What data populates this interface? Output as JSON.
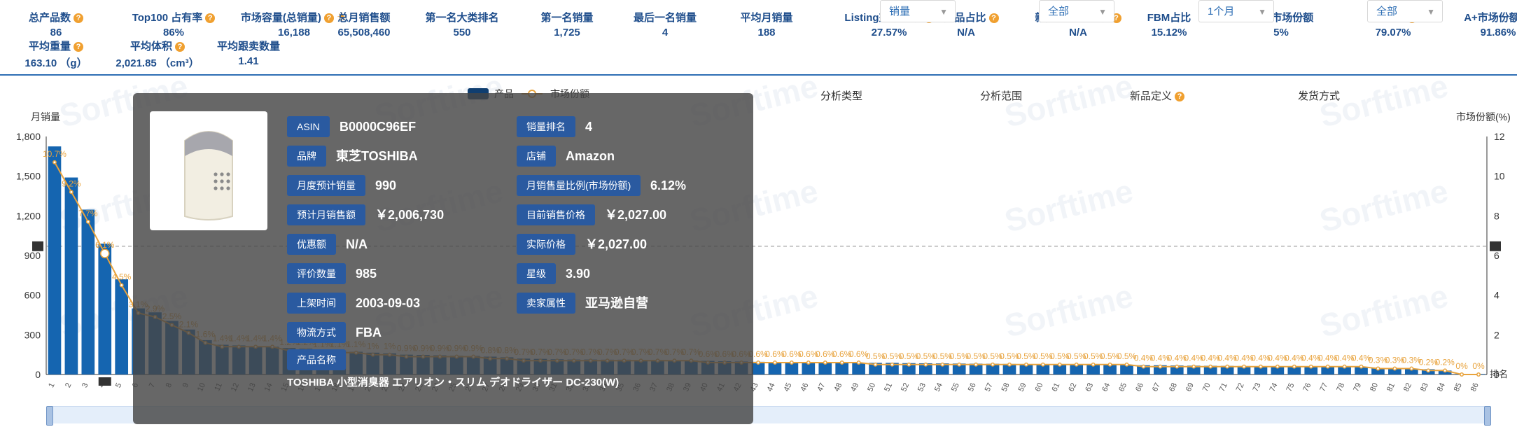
{
  "stats": [
    {
      "label": "总产品数",
      "value": "86",
      "help": true
    },
    {
      "label": "Top100 占有率",
      "value": "86%",
      "help": true
    },
    {
      "label": "市场容量(总销量)",
      "value": "16,188",
      "help": true,
      "sun": true
    },
    {
      "label": "总月销售额",
      "value": "65,508,460"
    },
    {
      "label": "第一名大类排名",
      "value": "550"
    },
    {
      "label": "第一名销量",
      "value": "1,725"
    },
    {
      "label": "最后一名销量",
      "value": "4"
    },
    {
      "label": "平均月销量",
      "value": "188"
    },
    {
      "label": "Listing垄断系数",
      "value": "27.57%",
      "help": true
    },
    {
      "label": "新产品占比",
      "value": "N/A",
      "help": true
    },
    {
      "label": "新产品市场份额",
      "value": "N/A",
      "help": true
    },
    {
      "label": "FBM占比",
      "value": "15.12%"
    },
    {
      "label": "FBM市场份额",
      "value": "5%"
    },
    {
      "label": "A+占比",
      "value": "79.07%",
      "help": true
    },
    {
      "label": "A+市场份额",
      "value": "91.86%",
      "help": true
    },
    {
      "label": "平均重量",
      "value": "163.10 （g）",
      "help": true
    },
    {
      "label": "平均体积",
      "value": "2,021.85 （cm³）",
      "help": true
    },
    {
      "label": "平均跟卖数量",
      "value": "1.41"
    }
  ],
  "controls": [
    {
      "label": "分析类型",
      "value": "销量"
    },
    {
      "label": "分析范围",
      "value": "全部"
    },
    {
      "label": "新品定义",
      "value": "1个月",
      "help": true
    },
    {
      "label": "发货方式",
      "value": "全部"
    }
  ],
  "watermark": "Sorftime",
  "tooltip": {
    "fields": [
      {
        "label": "ASIN",
        "value": "B0000C96EF"
      },
      {
        "label": "销量排名",
        "value": "4"
      },
      {
        "label": "品牌",
        "value": "東芝TOSHIBA"
      },
      {
        "label": "店铺",
        "value": "Amazon"
      },
      {
        "label": "月度预计销量",
        "value": "990"
      },
      {
        "label": "月销售量比例(市场份额)",
        "value": "6.12%"
      },
      {
        "label": "预计月销售额",
        "value": "￥2,006,730"
      },
      {
        "label": "目前销售价格",
        "value": "￥2,027.00"
      },
      {
        "label": "优惠额",
        "value": "N/A"
      },
      {
        "label": "实际价格",
        "value": "￥2,027.00"
      },
      {
        "label": "评价数量",
        "value": "985"
      },
      {
        "label": "星级",
        "value": "3.90"
      },
      {
        "label": "上架时间",
        "value": "2003-09-03"
      },
      {
        "label": "卖家属性",
        "value": "亚马逊自营"
      },
      {
        "label": "物流方式",
        "value": "FBA"
      }
    ],
    "name_label": "产品名称",
    "name": "TOSHIBA 小型消臭器 エアリオン・スリム デオドライザー DC-230(W)"
  },
  "colors": {
    "bar": "#1565b0",
    "line": "#e8a33d",
    "label": "#e8a33d",
    "axis": "#666666",
    "header": "#1f4e8c"
  },
  "chart_data": {
    "type": "bar",
    "title": "",
    "legend": [
      "产品",
      "市场份额"
    ],
    "legend_position": "top-center",
    "ylabel_left": "月销量",
    "ylabel_right": "市场份额(%)",
    "xlabel": "排名",
    "ylim_left": [
      0,
      1800
    ],
    "yticks_left": [
      "0",
      "300",
      "600",
      "900",
      "1,200",
      "1,500",
      "1,800"
    ],
    "ylim_right": [
      0,
      12
    ],
    "yticks_right": [
      "0",
      "2",
      "4",
      "6",
      "8",
      "10",
      "12"
    ],
    "mean_line": 970,
    "highlight_index": 4,
    "categories": [
      "1",
      "2",
      "3",
      "4",
      "5",
      "6",
      "7",
      "8",
      "9",
      "10",
      "11",
      "12",
      "13",
      "14",
      "15",
      "16",
      "17",
      "18",
      "19",
      "20",
      "21",
      "22",
      "23",
      "24",
      "25",
      "26",
      "27",
      "28",
      "29",
      "30",
      "31",
      "32",
      "33",
      "34",
      "35",
      "36",
      "37",
      "38",
      "39",
      "40",
      "41",
      "42",
      "43",
      "44",
      "45",
      "46",
      "47",
      "48",
      "49",
      "50",
      "51",
      "52",
      "53",
      "54",
      "55",
      "56",
      "57",
      "58",
      "59",
      "60",
      "61",
      "62",
      "63",
      "64",
      "65",
      "66",
      "67",
      "68",
      "69",
      "70",
      "71",
      "72",
      "73",
      "74",
      "75",
      "76",
      "77",
      "78",
      "79",
      "80",
      "81",
      "82",
      "83",
      "84",
      "85",
      "86"
    ],
    "series": [
      {
        "name": "产品",
        "axis": "left",
        "values": [
          1725,
          1490,
          1247,
          990,
          720,
          500,
          470,
          405,
          340,
          260,
          225,
          220,
          210,
          210,
          200,
          195,
          185,
          180,
          172,
          165,
          160,
          150,
          148,
          145,
          142,
          140,
          135,
          130,
          120,
          118,
          115,
          113,
          113,
          112,
          112,
          110,
          110,
          108,
          106,
          103,
          100,
          98,
          96,
          95,
          95,
          93,
          92,
          92,
          90,
          88,
          88,
          86,
          85,
          84,
          83,
          82,
          81,
          80,
          79,
          78,
          78,
          76,
          75,
          75,
          74,
          70,
          70,
          68,
          67,
          66,
          65,
          64,
          63,
          62,
          61,
          60,
          60,
          58,
          57,
          50,
          48,
          45,
          40,
          30,
          4,
          4
        ]
      },
      {
        "name": "市场份额",
        "axis": "right",
        "values": [
          10.7,
          9.2,
          7.7,
          6.1,
          4.5,
          3.1,
          2.9,
          2.5,
          2.1,
          1.6,
          1.4,
          1.4,
          1.4,
          1.4,
          1.2,
          1.2,
          1.1,
          1.1,
          1.1,
          1.0,
          1.0,
          0.9,
          0.9,
          0.9,
          0.9,
          0.9,
          0.8,
          0.8,
          0.7,
          0.7,
          0.7,
          0.7,
          0.7,
          0.7,
          0.7,
          0.7,
          0.7,
          0.7,
          0.7,
          0.6,
          0.6,
          0.6,
          0.6,
          0.6,
          0.6,
          0.6,
          0.6,
          0.6,
          0.6,
          0.5,
          0.5,
          0.5,
          0.5,
          0.5,
          0.5,
          0.5,
          0.5,
          0.5,
          0.5,
          0.5,
          0.5,
          0.5,
          0.5,
          0.5,
          0.5,
          0.4,
          0.4,
          0.4,
          0.4,
          0.4,
          0.4,
          0.4,
          0.4,
          0.4,
          0.4,
          0.4,
          0.4,
          0.4,
          0.4,
          0.3,
          0.3,
          0.3,
          0.2,
          0.2,
          0.0,
          0.0
        ],
        "labels": [
          "10.7%",
          "9.2%",
          "7.7%",
          "6.1%",
          "4.5%",
          "3.1%",
          "2.9%",
          "2.5%",
          "2.1%",
          "1.6%",
          "1.4%",
          "1.4%",
          "1.4%",
          "1.4%",
          "1.2%",
          "1.2%",
          "1.1%",
          "1.1%",
          "1.1%",
          "1%",
          "1%",
          "0.9%",
          "0.9%",
          "0.9%",
          "0.9%",
          "0.9%",
          "0.8%",
          "0.8%",
          "0.7%",
          "0.7%",
          "0.7%",
          "0.7%",
          "0.7%",
          "0.7%",
          "0.7%",
          "0.7%",
          "0.7%",
          "0.7%",
          "0.7%",
          "0.6%",
          "0.6%",
          "0.6%",
          "0.6%",
          "0.6%",
          "0.6%",
          "0.6%",
          "0.6%",
          "0.6%",
          "0.6%",
          "0.5%",
          "0.5%",
          "0.5%",
          "0.5%",
          "0.5%",
          "0.5%",
          "0.5%",
          "0.5%",
          "0.5%",
          "0.5%",
          "0.5%",
          "0.5%",
          "0.5%",
          "0.5%",
          "0.5%",
          "0.5%",
          "0.4%",
          "0.4%",
          "0.4%",
          "0.4%",
          "0.4%",
          "0.4%",
          "0.4%",
          "0.4%",
          "0.4%",
          "0.4%",
          "0.4%",
          "0.4%",
          "0.4%",
          "0.4%",
          "0.3%",
          "0.3%",
          "0.3%",
          "0.2%",
          "0.2%",
          "0%",
          "0%"
        ]
      }
    ]
  }
}
